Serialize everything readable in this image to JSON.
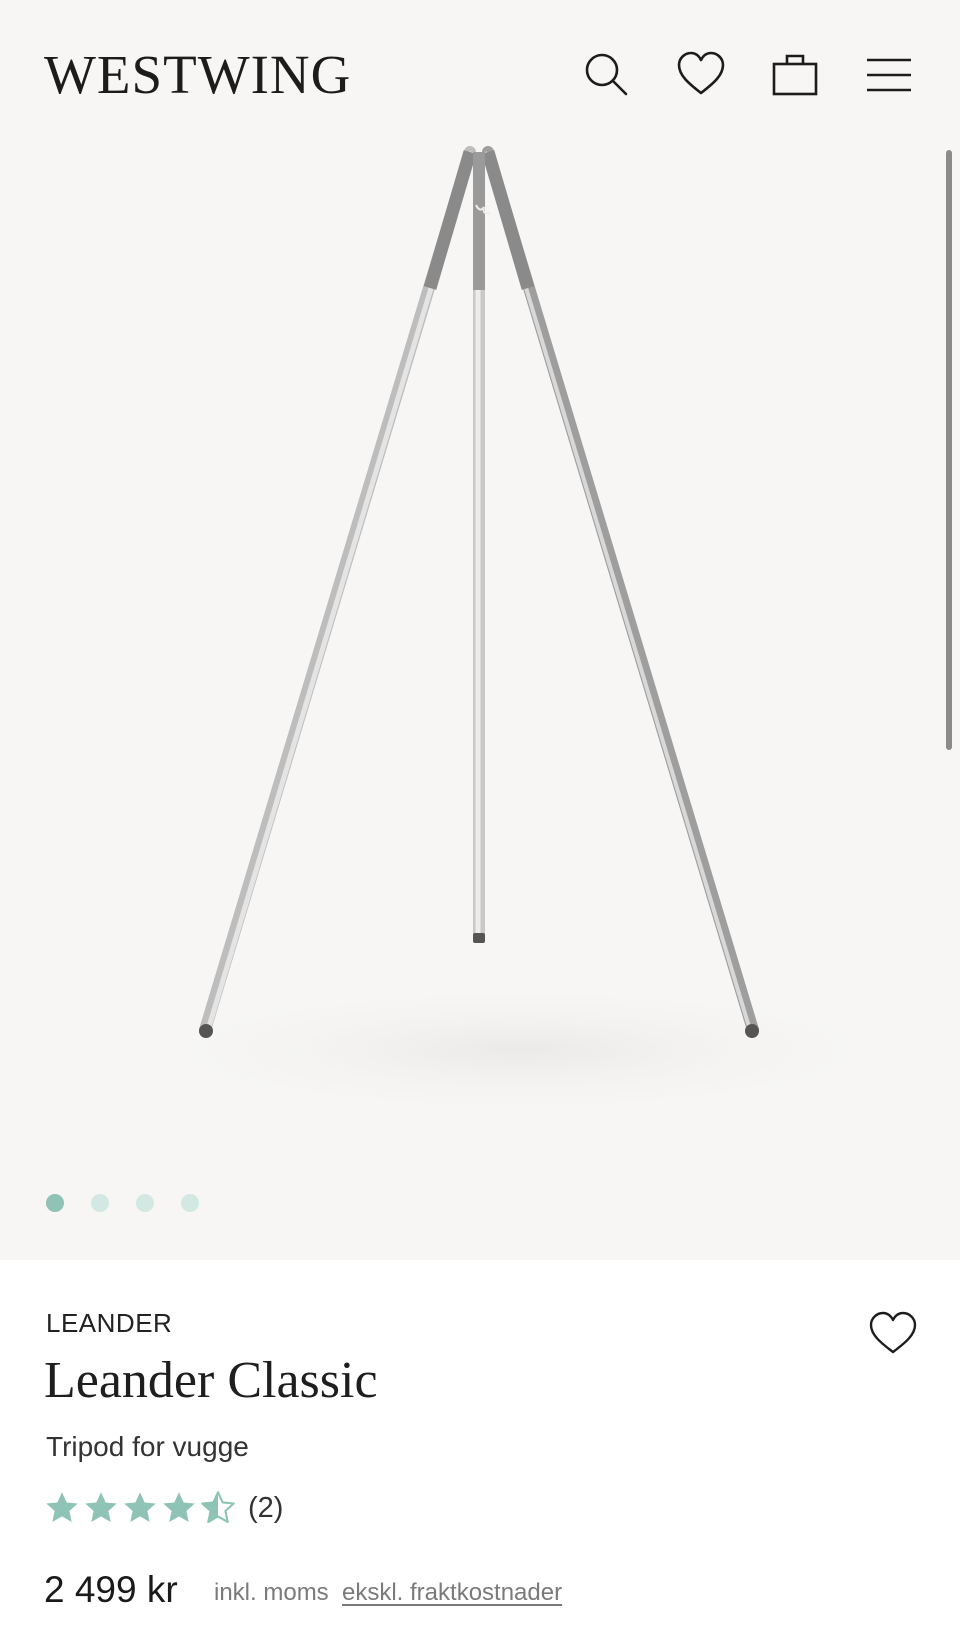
{
  "header": {
    "logo": "WESTWING",
    "icons": [
      "search-icon",
      "heart-icon",
      "shopping-bag-icon",
      "menu-icon"
    ]
  },
  "gallery": {
    "image_count": 4,
    "active_index": 0
  },
  "product": {
    "brand": "LEANDER",
    "name": "Leander Classic",
    "subtitle": "Tripod for vugge",
    "rating": 4.5,
    "rating_count": "(2)",
    "price": "2 499 kr",
    "vat_note": "inkl. moms",
    "shipping_note": "ekskl. fraktkostnader"
  },
  "colors": {
    "accent": "#8ec3b5",
    "accent_light": "#d3e8e2",
    "hero_background": "#f7f6f4"
  }
}
